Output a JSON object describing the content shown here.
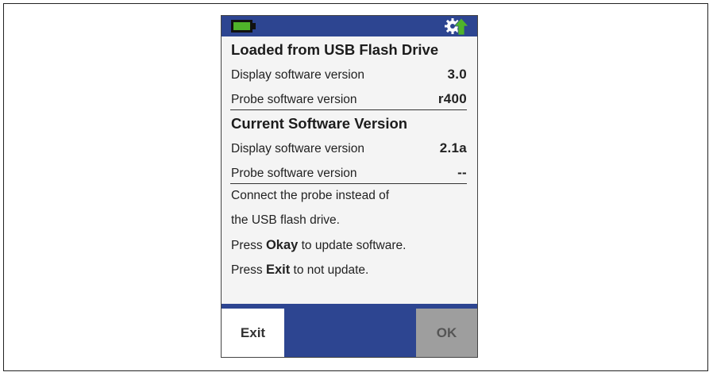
{
  "status": {
    "battery_icon": "battery-icon",
    "update_icon": "gear-update-icon",
    "battery_color": "#4fb32a",
    "bar_color": "#2d4591"
  },
  "loaded": {
    "heading": "Loaded from USB Flash Drive",
    "display_label": "Display software version",
    "display_value": "3.0",
    "probe_label": "Probe software version",
    "probe_value": "r400"
  },
  "current": {
    "heading": "Current Software Version",
    "display_label": "Display software version",
    "display_value": "2.1a",
    "probe_label": "Probe software version",
    "probe_value": "--"
  },
  "message": {
    "line1": "Connect the probe instead of",
    "line2": "the USB flash drive.",
    "line3_pre": "Press ",
    "line3_bold": "Okay",
    "line3_post": " to update software.",
    "line4_pre": "Press ",
    "line4_bold": "Exit",
    "line4_post": " to not update."
  },
  "buttons": {
    "exit_label": "Exit",
    "ok_label": "OK"
  }
}
